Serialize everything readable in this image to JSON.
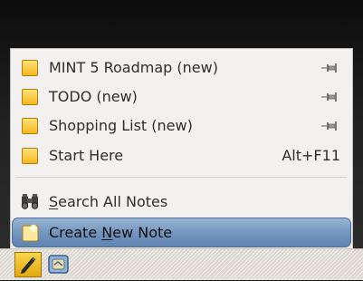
{
  "menu": {
    "notes": [
      {
        "label": "MINT 5 Roadmap (new)",
        "pinned": true
      },
      {
        "label": "TODO (new)",
        "pinned": true
      },
      {
        "label": "Shopping List (new)",
        "pinned": true
      },
      {
        "label": "Start Here",
        "accelerator": "Alt+F11"
      }
    ],
    "search": {
      "mnemonic": "S",
      "rest": "earch All Notes"
    },
    "create": {
      "pre": "Create ",
      "mnemonic": "N",
      "post": "ew Note"
    }
  },
  "icons": {
    "note": "sticky-note-icon",
    "pin": "pin-icon",
    "search": "binoculars-icon",
    "create": "new-note-icon",
    "taskbar_tomboy": "tomboy-note-pencil-icon",
    "taskbar_other": "applet-icon"
  },
  "colors": {
    "highlight": "#7496bf",
    "note_yellow": "#f6b81f"
  }
}
